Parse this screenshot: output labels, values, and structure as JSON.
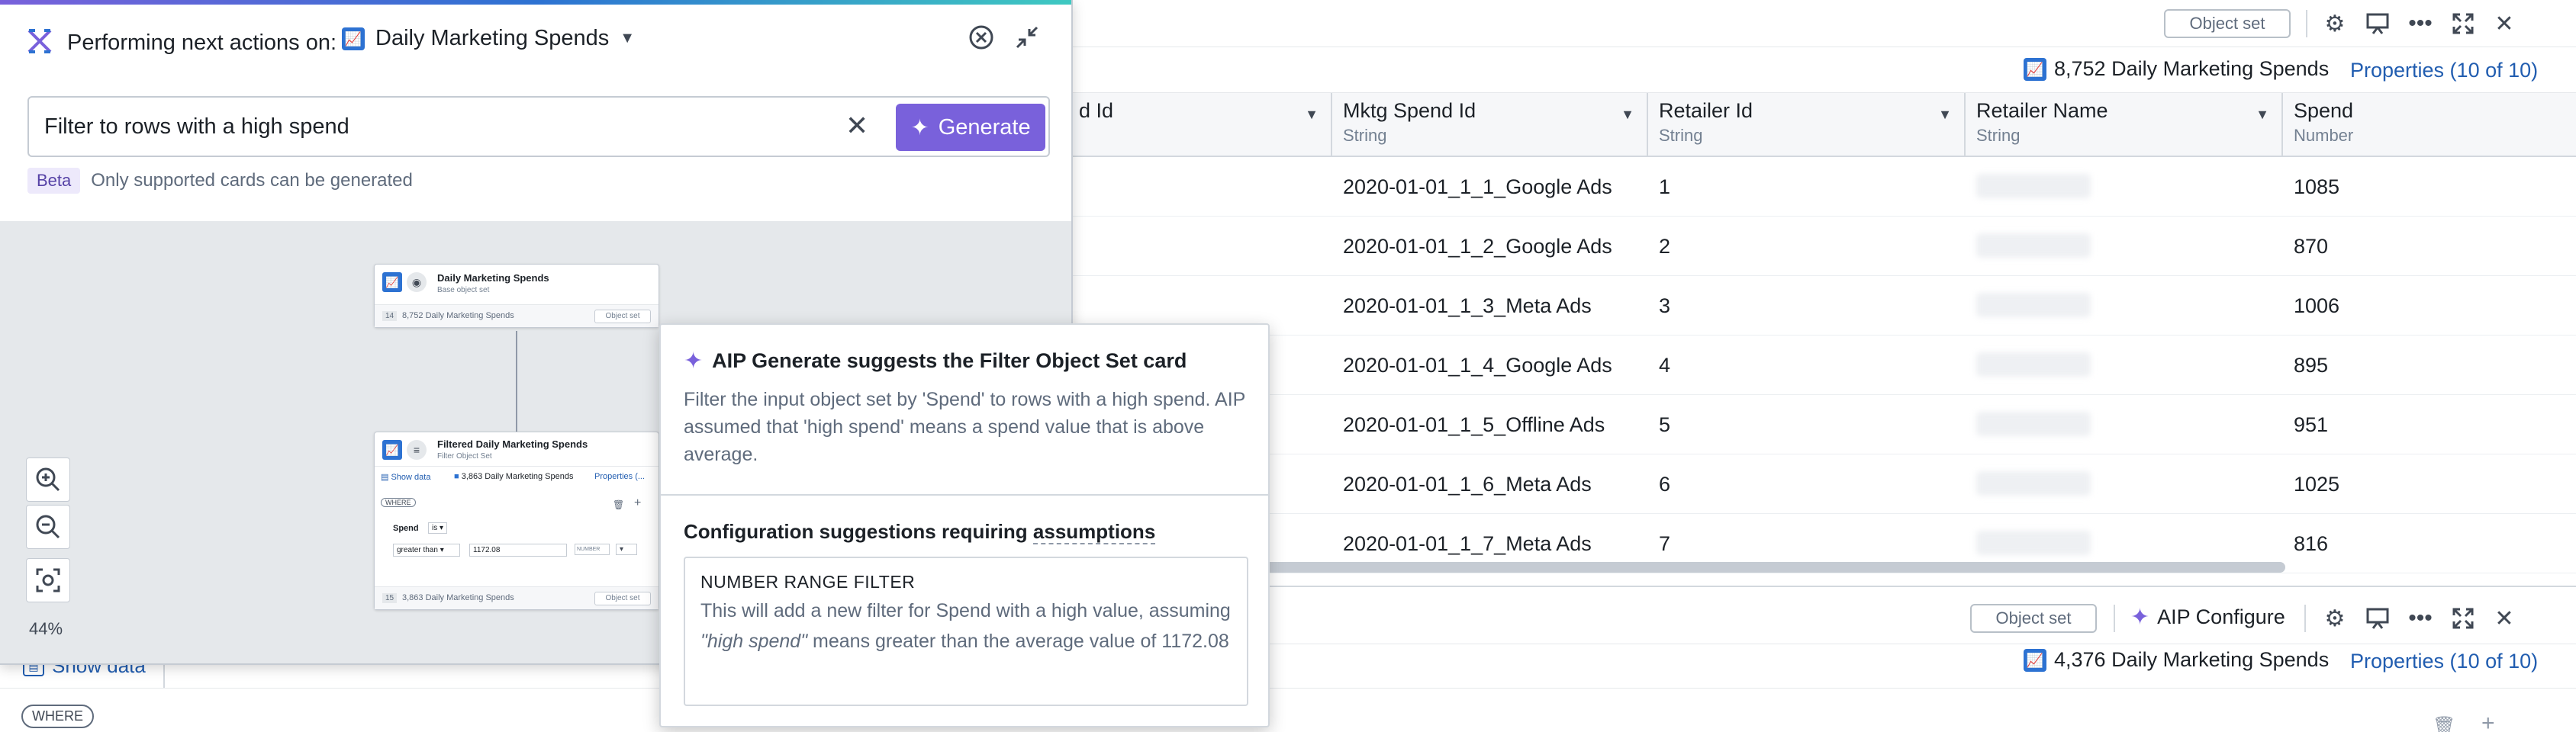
{
  "background_table": {
    "toolbar": {
      "object_set_button": "Object set"
    },
    "count_label": "8,752 Daily Marketing Spends",
    "properties_link": "Properties (10 of 10)",
    "columns": [
      {
        "name": "d Id",
        "type": ""
      },
      {
        "name": "Mktg Spend Id",
        "type": "String"
      },
      {
        "name": "Retailer Id",
        "type": "String"
      },
      {
        "name": "Retailer Name",
        "type": "String"
      },
      {
        "name": "Spend",
        "type": "Number"
      }
    ],
    "rows": [
      {
        "mktg_spend_id": "2020-01-01_1_1_Google Ads",
        "retailer_id": "1",
        "spend": "1085"
      },
      {
        "mktg_spend_id": "2020-01-01_1_2_Google Ads",
        "retailer_id": "2",
        "spend": "870"
      },
      {
        "mktg_spend_id": "2020-01-01_1_3_Meta Ads",
        "retailer_id": "3",
        "spend": "1006"
      },
      {
        "mktg_spend_id": "2020-01-01_1_4_Google Ads",
        "retailer_id": "4",
        "spend": "895"
      },
      {
        "mktg_spend_id": "2020-01-01_1_5_Offline Ads",
        "retailer_id": "5",
        "spend": "951"
      },
      {
        "mktg_spend_id": "2020-01-01_1_6_Meta Ads",
        "retailer_id": "6",
        "spend": "1025"
      },
      {
        "mktg_spend_id": "2020-01-01_1_7_Meta Ads",
        "retailer_id": "7",
        "spend": "816"
      }
    ]
  },
  "bottom_card": {
    "object_set_button": "Object set",
    "aip_configure": "AIP Configure",
    "count_label": "4,376 Daily Marketing Spends",
    "properties_link": "Properties (10 of 10)",
    "show_data": "Show data",
    "where_tag": "WHERE"
  },
  "panel": {
    "performing_label": "Performing next actions on:",
    "object_name": "Daily Marketing Spends",
    "prompt_value": "Filter to rows with a high spend",
    "generate_label": "Generate",
    "beta_tag": "Beta",
    "beta_note": "Only supported cards can be generated",
    "zoom_level": "44%",
    "graph": {
      "card1": {
        "title": "Daily Marketing Spends",
        "subtitle": "Base object set",
        "footer_count": "8,752 Daily Marketing Spends",
        "footer_badge": "14",
        "footer_button": "Object set"
      },
      "card2": {
        "title": "Filtered Daily Marketing Spends",
        "subtitle": "Filter Object Set",
        "show_data": "Show data",
        "count": "3,863 Daily Marketing Spends",
        "properties": "Properties (...",
        "where": "WHERE",
        "filter_field": "Spend",
        "filter_is": "is",
        "filter_operator": "greater than",
        "filter_value": "1172.08",
        "filter_unit": "NUMBER",
        "footer_count": "3,863 Daily Marketing Spends",
        "footer_badge": "15",
        "footer_button": "Object set"
      }
    }
  },
  "popover": {
    "title": "AIP Generate suggests the Filter Object Set card",
    "description": "Filter the input object set by 'Spend' to rows with a high spend. AIP assumed that 'high spend' means a spend value that is above average.",
    "config_heading_prefix": "Configuration suggestions requiring",
    "config_heading_term": "assumptions",
    "box_title": "NUMBER RANGE FILTER",
    "box_text_1": "This will add a new filter for Spend with a high value, assuming",
    "box_text_quote": "\"high spend\"",
    "box_text_2": "means greater than the average value of 1172.08"
  },
  "colors": {
    "accent_purple": "#7961db",
    "accent_blue": "#2d72d2",
    "link_blue": "#215db0"
  }
}
